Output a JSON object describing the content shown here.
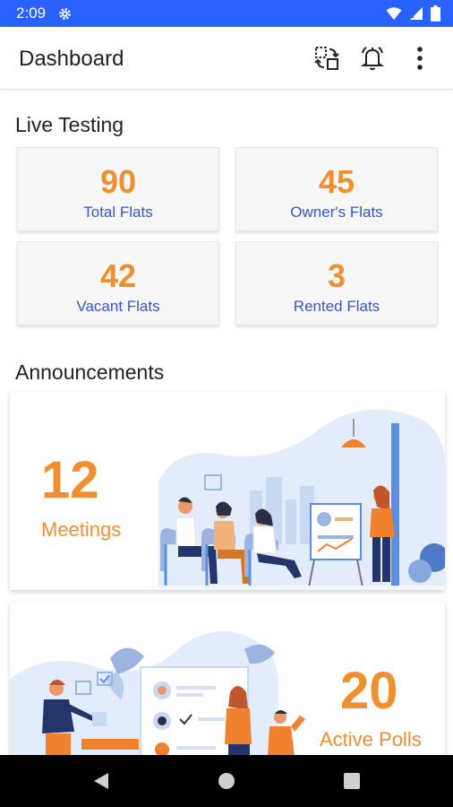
{
  "status_bar": {
    "time": "2:09",
    "icons": [
      "settings-icon",
      "wifi-icon",
      "signal-icon",
      "battery-icon"
    ]
  },
  "app_bar": {
    "title": "Dashboard",
    "actions": [
      "swap-icon",
      "bell-icon",
      "more-vert-icon"
    ]
  },
  "live_testing": {
    "title": "Live Testing",
    "stats": [
      {
        "value": "90",
        "label": "Total Flats"
      },
      {
        "value": "45",
        "label": "Owner's Flats"
      },
      {
        "value": "42",
        "label": "Vacant Flats"
      },
      {
        "value": "3",
        "label": "Rented Flats"
      }
    ]
  },
  "announcements": {
    "title": "Announcements",
    "cards": [
      {
        "value": "12",
        "label": "Meetings",
        "illustration": "meeting-illustration"
      },
      {
        "value": "20",
        "label": "Active Polls",
        "illustration": "voting-illustration"
      }
    ]
  },
  "colors": {
    "status_bar": "#2962ff",
    "accent_orange": "#ef8f2f",
    "label_blue": "#3a57c8"
  },
  "nav_bar": {
    "buttons": [
      "back-icon",
      "home-icon",
      "recents-icon"
    ]
  }
}
